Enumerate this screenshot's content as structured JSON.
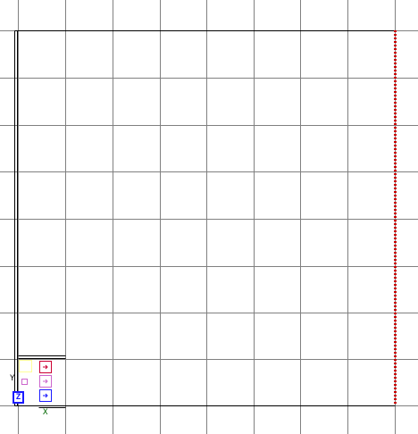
{
  "canvas": {
    "background": "#ffffff",
    "grid_color": "#808080",
    "frame_color": "#000000",
    "right_marker_color": "#cc0000"
  },
  "axis_gizmo": {
    "y_label": "Y",
    "x_label": "X",
    "z_label": "Z",
    "x_color": "#006600",
    "z_color": "#1a1aff",
    "button_colors": {
      "yellow": "#ffff99",
      "red": "#cc0033",
      "magenta": "#cc66cc",
      "blue": "#1a1aff"
    },
    "icons": [
      "axis-gizmo-yellow-box-icon",
      "axis-gizmo-red-arrow-icon",
      "axis-gizmo-magenta-box-icon",
      "axis-gizmo-magenta-arrow-icon",
      "axis-gizmo-blue-arrow-icon"
    ]
  }
}
